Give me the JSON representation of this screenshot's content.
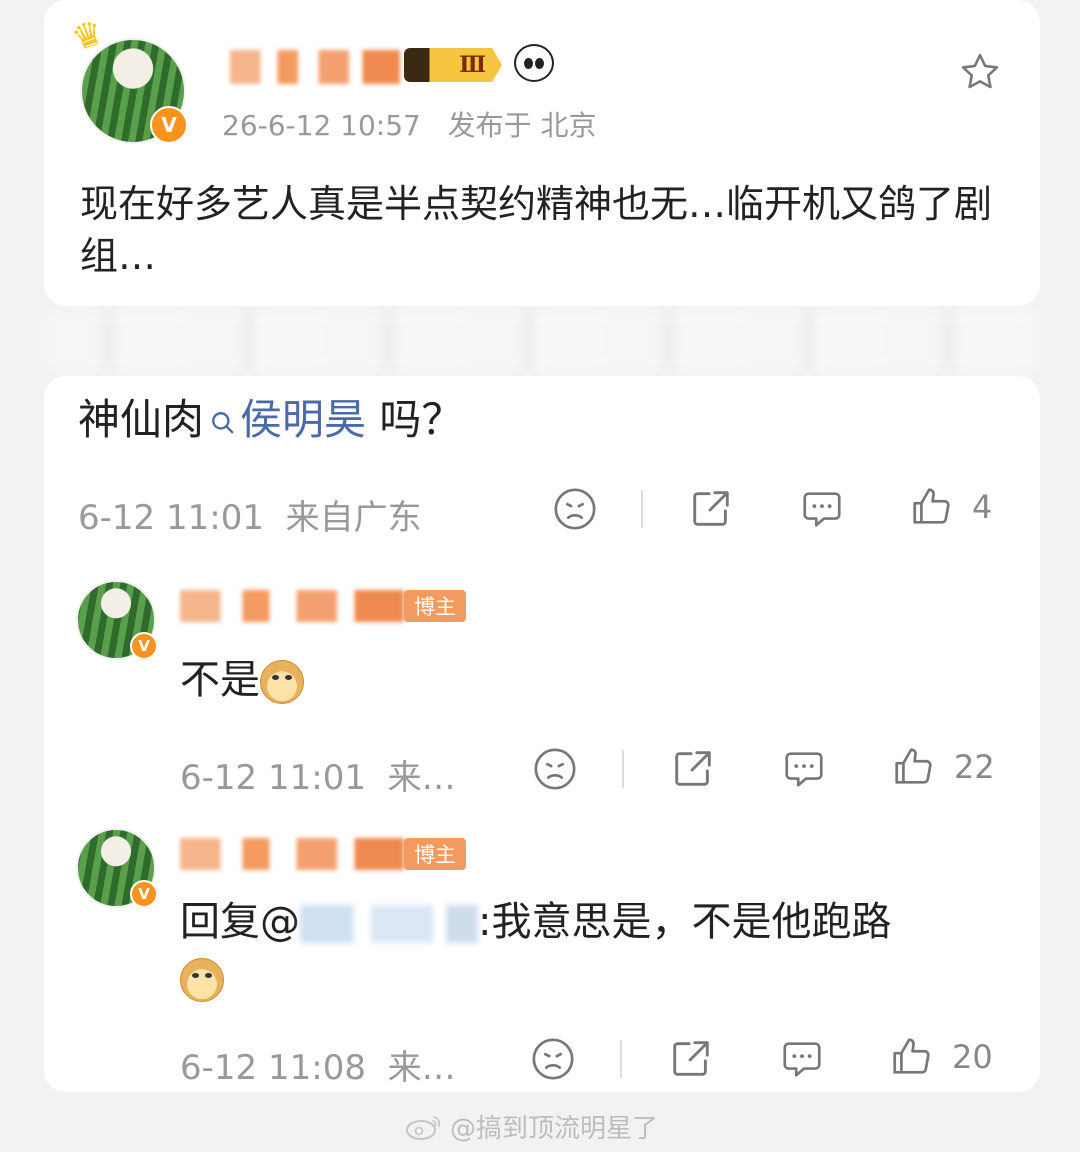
{
  "post": {
    "timestamp": "26-6-12 10:57",
    "location": "发布于 北京",
    "level_badge": "Ⅲ",
    "body": "现在好多艺人真是半点契约精神也无…临开机又鸽了剧组…"
  },
  "comment": {
    "prefix": "神仙肉",
    "mention": "侯明昊",
    "suffix": " 吗？",
    "time": "6-12 11:01",
    "source": "来自广东",
    "likes": "4"
  },
  "replies": [
    {
      "tag": "博主",
      "text": "不是",
      "time": "6-12 11:01",
      "source": "来…",
      "likes": "22"
    },
    {
      "tag": "博主",
      "reply_prefix": "回复@",
      "reply_suffix": ":我意思是，不是他跑路",
      "time": "6-12 11:08",
      "source": "来…",
      "likes": "20"
    }
  ],
  "watermark": "@搞到顶流明星了",
  "colors": {
    "accent_orange": "#f39a5e",
    "mention_blue": "#4a6aa8",
    "meta_gray": "#999999"
  },
  "icons": [
    "crown-icon",
    "verified-badge-icon",
    "star-icon",
    "dislike-icon",
    "share-icon",
    "comment-icon",
    "like-icon",
    "search-icon",
    "doge-emoji",
    "weibo-logo-icon"
  ]
}
